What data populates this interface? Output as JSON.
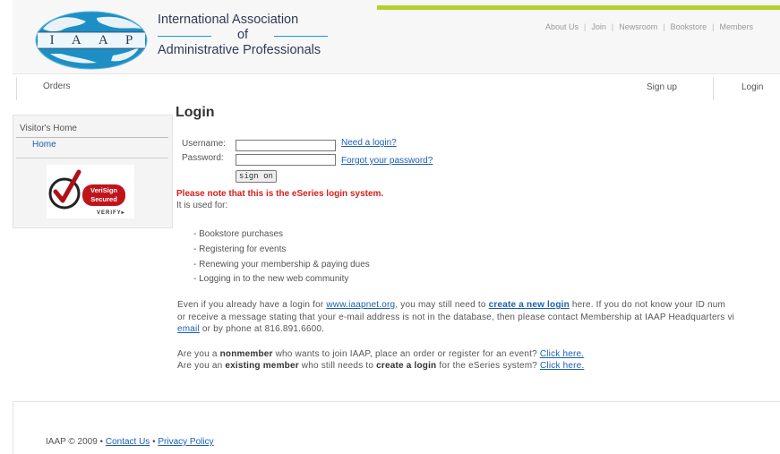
{
  "header": {
    "logo_letters": [
      "I",
      "A",
      "A",
      "P"
    ],
    "org_line1": "International Association",
    "org_line2": "of",
    "org_line3": "Administrative Professionals",
    "topnav": [
      "About Us",
      "Join",
      "Newsroom",
      "Bookstore",
      "Members"
    ],
    "accent_green": "#b6d02b"
  },
  "nav": {
    "orders": "Orders",
    "signup": "Sign up",
    "login": "Login"
  },
  "sidebar": {
    "title": "Visitor's Home",
    "home": "Home",
    "verisign_line1": "VeriSign",
    "verisign_line2": "Secured",
    "verisign_line3": "VERIFY▸"
  },
  "login": {
    "title": "Login",
    "username_label": "Username:",
    "password_label": "Password:",
    "username_value": "",
    "password_value": "",
    "need_login": "Need a login?",
    "forgot_password": "Forgot your password?",
    "sign_on": "sign on"
  },
  "notice": "Please note that this is the eSeries login system.",
  "used_for": "It is used for:",
  "uses": [
    "- Bookstore purchases",
    "- Registering for events",
    "- Renewing your membership & paying dues",
    "- Logging in to the new web community"
  ],
  "para1": {
    "t1": "Even if you already have a login for ",
    "link1": "www.iaapnet.org",
    "t2": ", you may still need to ",
    "link2": "create a new login",
    "t3": " here. If you do not know your ID num",
    "line2": "or receive a message stating that your e-mail address is not in the database, then please contact Membership at IAAP Headquarters vi",
    "link3": "email",
    "t4": " or by phone at 816.891.6600."
  },
  "para2": {
    "t1": "Are you a ",
    "b1": "nonmember",
    "t2": " who wants to join IAAP, place an order or register for an event? ",
    "link1": "Click here.",
    "t3": "Are you an ",
    "b2": "existing member",
    "t4": " who still needs to ",
    "b3": "create a login",
    "t5": " for the eSeries system? ",
    "link2": "Click here."
  },
  "footer": {
    "copyright": "IAAP © 2009 • ",
    "contact": "Contact Us",
    "sep": " • ",
    "privacy": "Privacy Policy"
  }
}
